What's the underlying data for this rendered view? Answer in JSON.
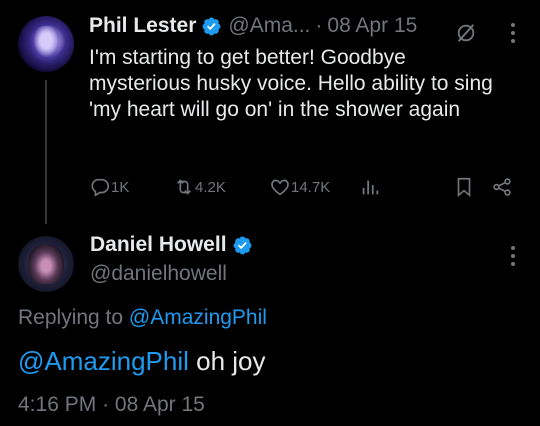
{
  "parent_tweet": {
    "display_name": "Phil Lester",
    "handle": "@Ama...",
    "separator": "·",
    "date": "08 Apr 15",
    "text": "I'm starting to get better! Goodbye mysterious husky voice. Hello ability to sing 'my heart will go on' in the shower again",
    "actions": {
      "replies": "1K",
      "retweets": "4.2K",
      "likes": "14.7K"
    }
  },
  "reply_tweet": {
    "display_name": "Daniel Howell",
    "handle": "@danielhowell",
    "replying_prefix": "Replying to",
    "replying_to": "@AmazingPhil",
    "mention": "@AmazingPhil",
    "text": " oh joy",
    "time": "4:16 PM",
    "separator": "·",
    "date": "08 Apr 15"
  },
  "colors": {
    "background": "#000000",
    "text": "#e7e9ea",
    "muted": "#71767b",
    "accent": "#1d9bf0"
  },
  "icons": [
    "verified-badge-icon",
    "grok-icon",
    "more-icon",
    "reply-icon",
    "retweet-icon",
    "like-icon",
    "views-icon",
    "bookmark-icon",
    "share-icon"
  ]
}
